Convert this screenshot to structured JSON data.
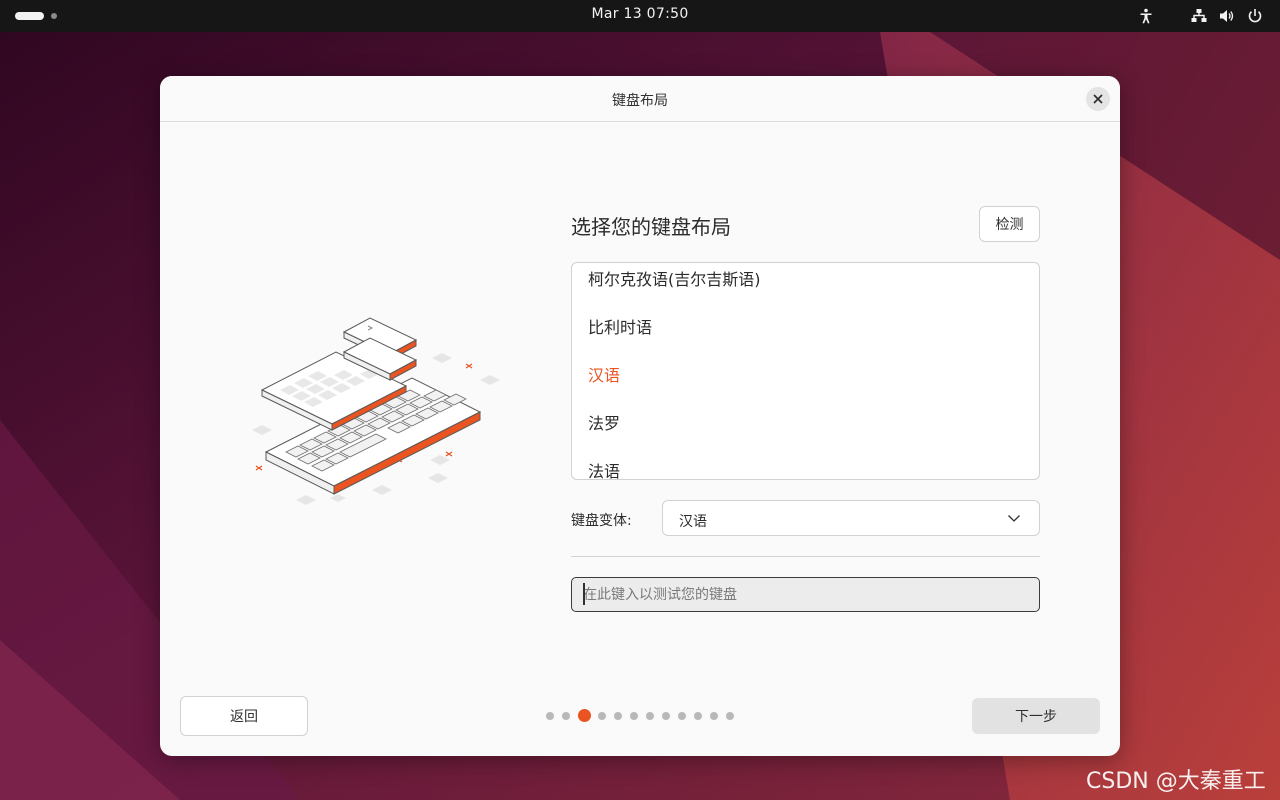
{
  "topbar": {
    "clock": "Mar 13  07:50",
    "icons": [
      "activities-indicator",
      "accessibility-icon",
      "network-icon",
      "volume-icon",
      "power-icon"
    ]
  },
  "dialog": {
    "title": "键盘布局",
    "heading": "选择您的键盘布局",
    "detect_label": "检测",
    "layouts": [
      {
        "label": "柯尔克孜语(吉尔吉斯语)",
        "selected": false
      },
      {
        "label": "比利时语",
        "selected": false
      },
      {
        "label": "汉语",
        "selected": true
      },
      {
        "label": "法罗",
        "selected": false
      },
      {
        "label": "法语",
        "selected": false
      }
    ],
    "variant_label": "键盘变体:",
    "variant_value": "汉语",
    "test_placeholder": "在此键入以测试您的键盘",
    "back_label": "返回",
    "next_label": "下一步",
    "progress": {
      "total": 12,
      "current": 3
    }
  },
  "colors": {
    "accent": "#e95420",
    "topbar": "#161616",
    "dialog_bg": "#fafafa"
  },
  "watermark": "CSDN @大秦重工"
}
